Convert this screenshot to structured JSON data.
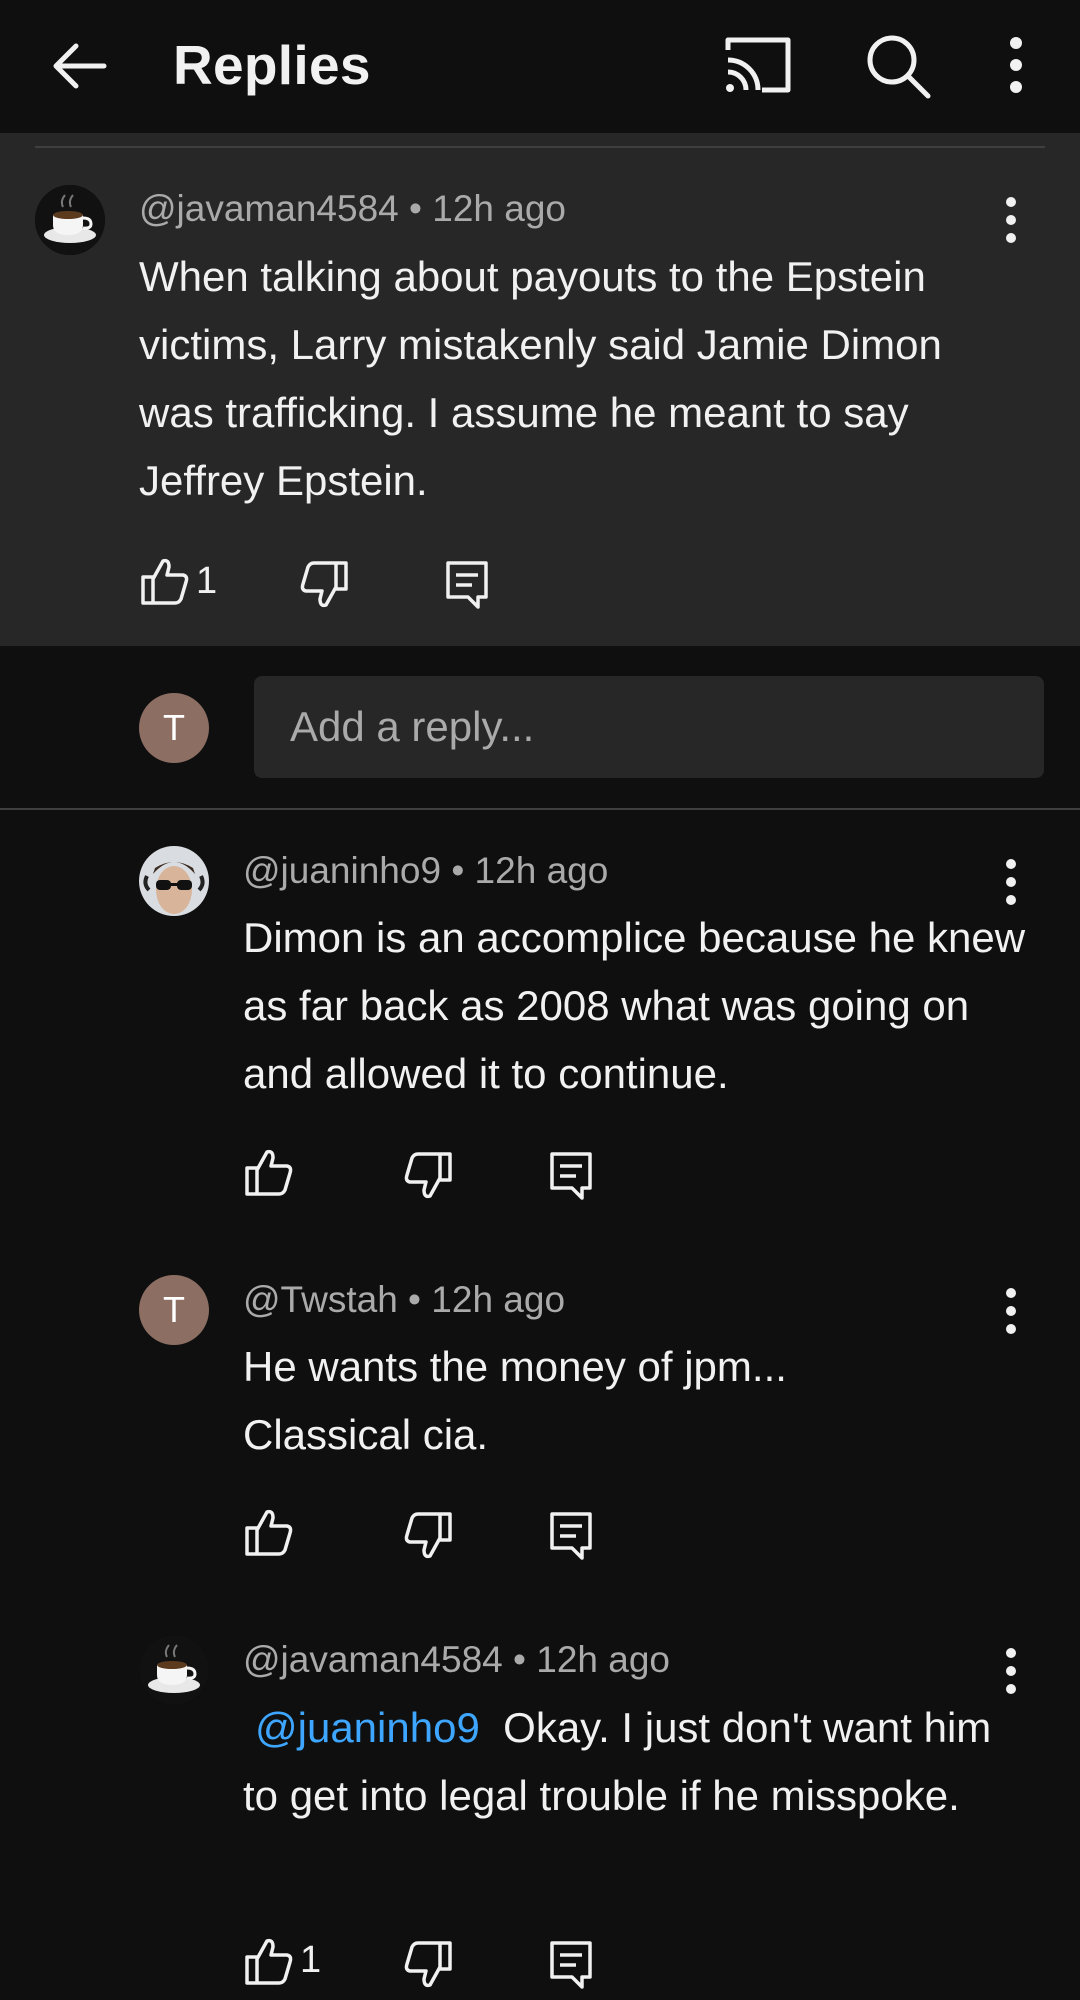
{
  "header": {
    "title": "Replies",
    "icons": [
      "back-arrow-icon",
      "cast-icon",
      "search-icon",
      "more-vert-icon"
    ]
  },
  "parent_comment": {
    "author": "@javaman4584",
    "time": "12h ago",
    "meta": "@javaman4584 • 12h ago",
    "text": "When talking about payouts to the Epstein victims, Larry mistakenly said Jamie Dimon was trafficking. I assume he meant to say Jeffrey Epstein.",
    "likes": "1"
  },
  "reply_input": {
    "avatar_letter": "T",
    "placeholder": "Add a reply..."
  },
  "replies": [
    {
      "author": "@juaninho9",
      "meta": "@juaninho9 • 12h ago",
      "text": "Dimon is an accomplice because he knew as far back as 2008 what was going on and allowed it to continue.",
      "likes": ""
    },
    {
      "author": "@Twstah",
      "avatar_letter": "T",
      "meta": "@Twstah • 12h ago",
      "text": "He wants the money of jpm... Classical cia.",
      "likes": ""
    },
    {
      "author": "@javaman4584",
      "meta": "@javaman4584 • 12h ago",
      "mention": "@juaninho9",
      "text": "Okay. I just don't want him to get into legal trouble if he misspoke.",
      "likes": "1"
    }
  ],
  "colors": {
    "background": "#0f0f0f",
    "card": "#272727",
    "meta_text": "#aaaaaa",
    "mention": "#3ea6ff",
    "avatar_letter_bg": "#8d6e63"
  }
}
